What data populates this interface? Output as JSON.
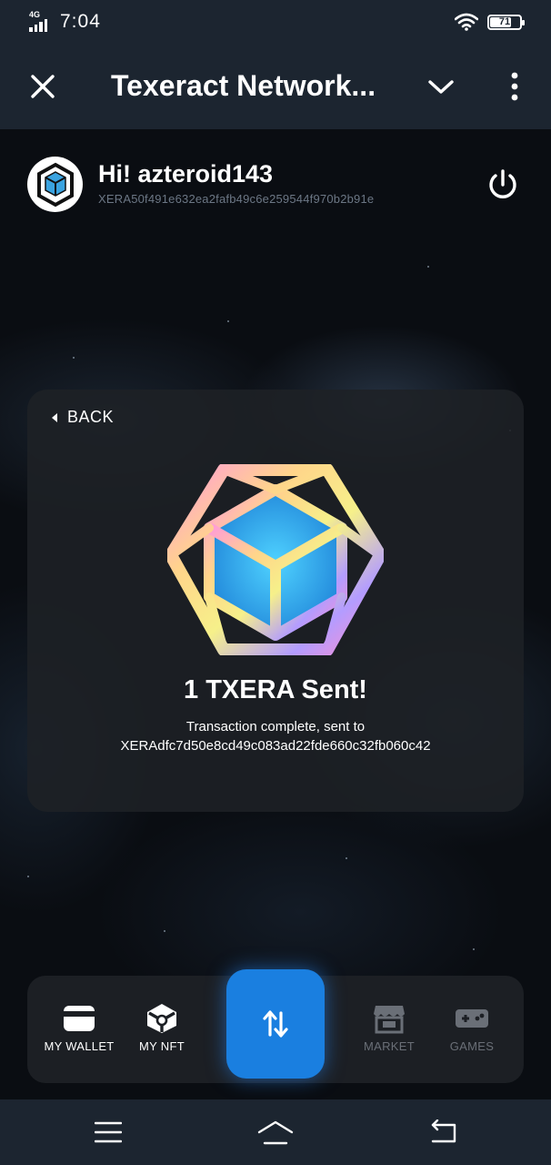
{
  "status_bar": {
    "network": "4G",
    "time": "7:04",
    "battery": "71"
  },
  "app_bar": {
    "title": "Texeract Network...",
    "close_icon": "close-icon",
    "dropdown_icon": "chevron-down-icon",
    "menu_icon": "more-vertical-icon"
  },
  "header": {
    "greeting": "Hi! azteroid143",
    "address": "XERA50f491e632ea2fafb49c6e259544f970b2b91e",
    "logout_icon": "power-icon"
  },
  "card": {
    "back_label": "BACK",
    "title": "1 TXERA Sent!",
    "subtitle_line1": "Transaction complete, sent to",
    "subtitle_line2": "XERAdfc7d50e8cd49c083ad22fde660c32fb060c42"
  },
  "bottom_nav": {
    "items": [
      {
        "label": "MY WALLET",
        "icon": "wallet-icon",
        "active": true
      },
      {
        "label": "MY NFT",
        "icon": "nft-cube-icon",
        "active": true
      },
      {
        "label": "MARKET",
        "icon": "market-store-icon",
        "active": false
      },
      {
        "label": "GAMES",
        "icon": "gamepad-icon",
        "active": false
      }
    ],
    "fab_icon": "transfer-arrows-icon"
  },
  "system_nav": {
    "menu_icon": "menu-lines-icon",
    "home_icon": "home-icon",
    "back_icon": "back-return-icon"
  },
  "colors": {
    "accent": "#1a7fe0",
    "header_bg": "#1c2530",
    "card_bg": "#1e2126"
  }
}
